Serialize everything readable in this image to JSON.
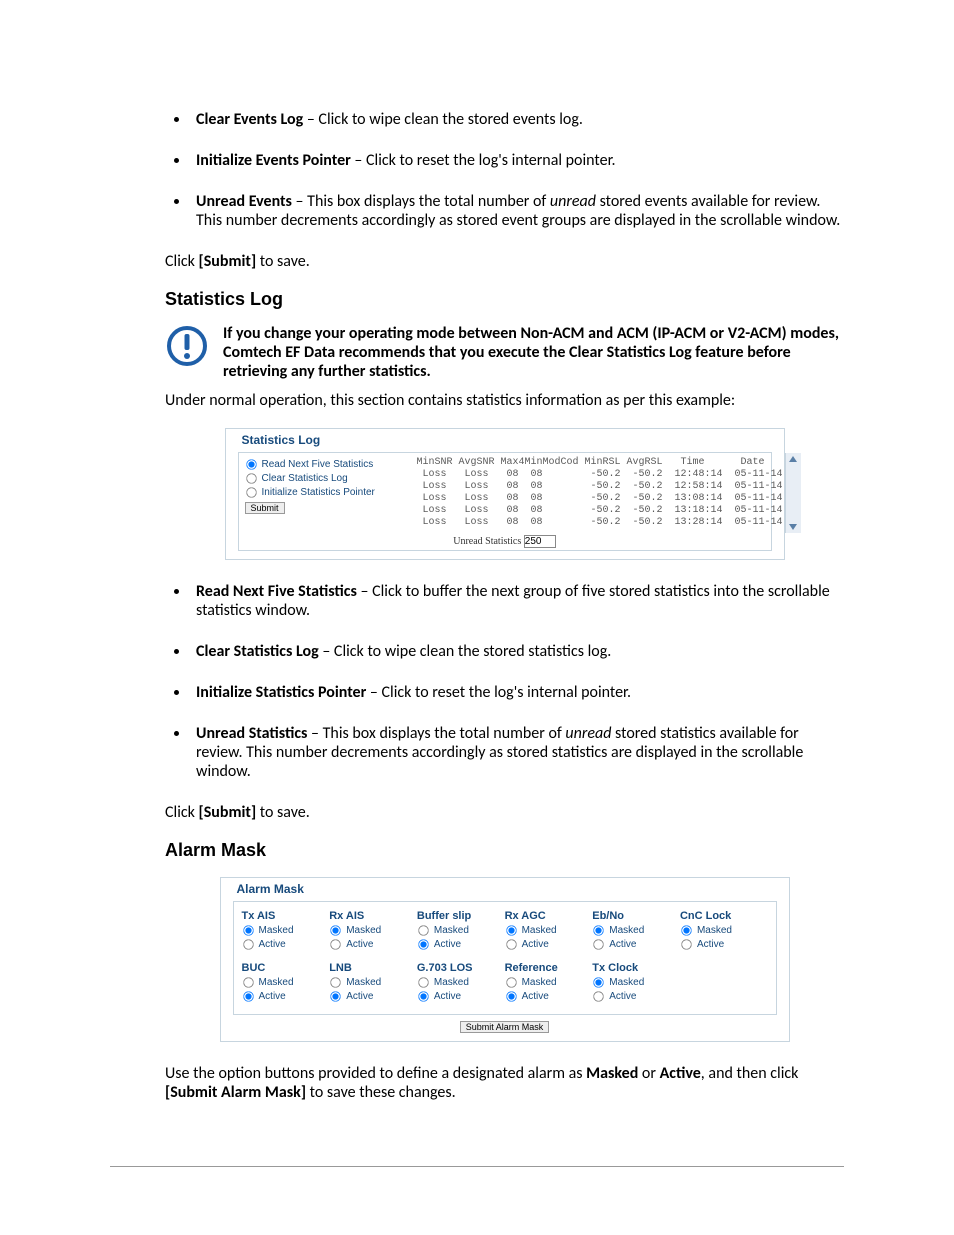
{
  "events_list": [
    {
      "term": "Clear Events Log",
      "desc": " – Click to wipe clean the stored events log."
    },
    {
      "term": "Initialize Events Pointer",
      "desc": " – Click to reset the log's internal pointer."
    },
    {
      "term": "Unread Events",
      "desc_html": " – This box displays the total number of <em>unread</em> stored events available for review. This number decrements accordingly as stored event groups are displayed in the scrollable window."
    }
  ],
  "submit_hint_pre": "Click ",
  "submit_hint_bold": "[Submit]",
  "submit_hint_post": " to save.",
  "statlog_heading": "Statistics Log",
  "notice_text": "If you change your operating mode between Non-ACM and ACM (IP-ACM or V2-ACM) modes, Comtech EF Data recommends that you execute the Clear Statistics Log feature before retrieving any further statistics.",
  "statlog_intro": "Under normal operation, this section contains statistics information as per this example:",
  "stat_panel": {
    "title": "Statistics Log",
    "radios": [
      "Read Next Five Statistics",
      "Clear Statistics Log",
      "Initialize Statistics Pointer"
    ],
    "submit": "Submit",
    "header": "MinSNR AvgSNR Max4MinModCod MinRSL AvgRSL   Time      Date",
    "rows": [
      " Loss   Loss   08  08        -50.2  -50.2  12:48:14  05-11-14",
      " Loss   Loss   08  08        -50.2  -50.2  12:58:14  05-11-14",
      " Loss   Loss   08  08        -50.2  -50.2  13:08:14  05-11-14",
      " Loss   Loss   08  08        -50.2  -50.2  13:18:14  05-11-14",
      " Loss   Loss   08  08        -50.2  -50.2  13:28:14  05-11-14"
    ],
    "unread_label": "Unread Statistics",
    "unread_value": "250"
  },
  "stats_list": [
    {
      "term": "Read Next Five Statistics",
      "desc": " – Click to buffer the next group of five stored statistics into the scrollable statistics window."
    },
    {
      "term": "Clear Statistics Log",
      "desc": " – Click to wipe clean the stored statistics log."
    },
    {
      "term": "Initialize Statistics Pointer",
      "desc": " – Click to reset the log's internal pointer."
    },
    {
      "term": "Unread Statistics",
      "desc_html": " – This box displays the total number of <em>unread</em> stored statistics available for review. This number decrements accordingly as stored statistics are displayed in the scrollable window."
    }
  ],
  "alarm_heading": "Alarm Mask",
  "alarm_panel": {
    "title": "Alarm Mask",
    "opt_masked": "Masked",
    "opt_active": "Active",
    "row1": [
      {
        "h": "Tx AIS",
        "sel": "Masked"
      },
      {
        "h": "Rx AIS",
        "sel": "Masked"
      },
      {
        "h": "Buffer slip",
        "sel": "Active"
      },
      {
        "h": "Rx AGC",
        "sel": "Masked"
      },
      {
        "h": "Eb/No",
        "sel": "Masked"
      },
      {
        "h": "CnC Lock",
        "sel": "Masked"
      }
    ],
    "row2": [
      {
        "h": "BUC",
        "sel": "Active"
      },
      {
        "h": "LNB",
        "sel": "Active"
      },
      {
        "h": "G.703 LOS",
        "sel": "Active"
      },
      {
        "h": "Reference",
        "sel": "Active"
      },
      {
        "h": "Tx Clock",
        "sel": "Masked"
      }
    ],
    "submit": "Submit Alarm Mask"
  },
  "alarm_outro_1": "Use the option buttons provided to define a designated alarm as ",
  "alarm_outro_b1": "Masked",
  "alarm_outro_2": " or ",
  "alarm_outro_b2": "Active",
  "alarm_outro_3": ", and then click ",
  "alarm_outro_b3": "[Submit Alarm Mask]",
  "alarm_outro_4": " to save these changes."
}
